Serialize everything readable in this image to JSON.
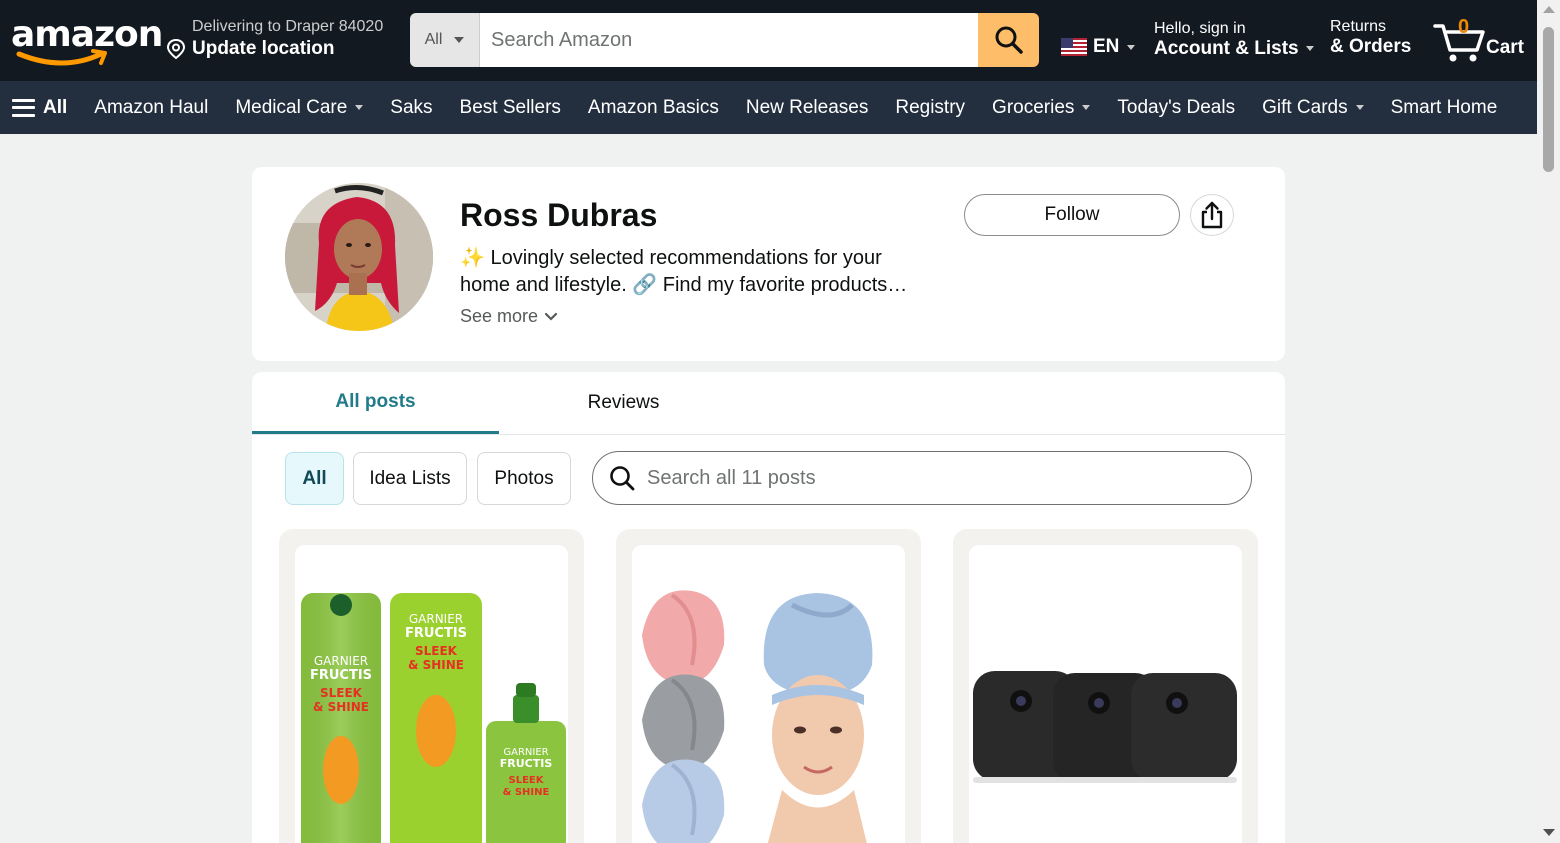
{
  "header": {
    "logo_text": "amazon",
    "deliver_line1": "Delivering to Draper 84020",
    "deliver_line2": "Update location",
    "search_dept": "All",
    "search_placeholder": "Search Amazon",
    "language": "EN",
    "account_line1": "Hello, sign in",
    "account_line2": "Account & Lists",
    "orders_line1": "Returns",
    "orders_line2": "& Orders",
    "cart_count": "0",
    "cart_label": "Cart"
  },
  "subnav": {
    "all_label": "All",
    "items": [
      {
        "label": "Amazon Haul",
        "dropdown": false
      },
      {
        "label": "Medical Care",
        "dropdown": true
      },
      {
        "label": "Saks",
        "dropdown": false
      },
      {
        "label": "Best Sellers",
        "dropdown": false
      },
      {
        "label": "Amazon Basics",
        "dropdown": false
      },
      {
        "label": "New Releases",
        "dropdown": false
      },
      {
        "label": "Registry",
        "dropdown": false
      },
      {
        "label": "Groceries",
        "dropdown": true
      },
      {
        "label": "Today's Deals",
        "dropdown": false
      },
      {
        "label": "Gift Cards",
        "dropdown": true
      },
      {
        "label": "Smart Home",
        "dropdown": false
      }
    ]
  },
  "profile": {
    "name": "Ross Dubras",
    "bio_line1": "✨ Lovingly selected recommendations for your",
    "bio_line2": "home and lifestyle. 🔗 Find my favorite products…",
    "see_more": "See more",
    "follow_label": "Follow"
  },
  "posts": {
    "tabs": [
      {
        "label": "All posts",
        "active": true
      },
      {
        "label": "Reviews",
        "active": false
      }
    ],
    "filters": [
      {
        "label": "All",
        "active": true
      },
      {
        "label": "Idea Lists",
        "active": false
      },
      {
        "label": "Photos",
        "active": false
      }
    ],
    "search_placeholder": "Search all 11 posts",
    "cards": [
      {
        "product": "hair-care-bottles"
      },
      {
        "product": "hair-towel-wraps"
      },
      {
        "product": "security-cameras"
      }
    ]
  },
  "colors": {
    "nav_bg": "#131921",
    "subnav_bg": "#232f3e",
    "search_button": "#febd69",
    "accent_teal": "#227b8a",
    "cart_orange": "#f08804"
  }
}
